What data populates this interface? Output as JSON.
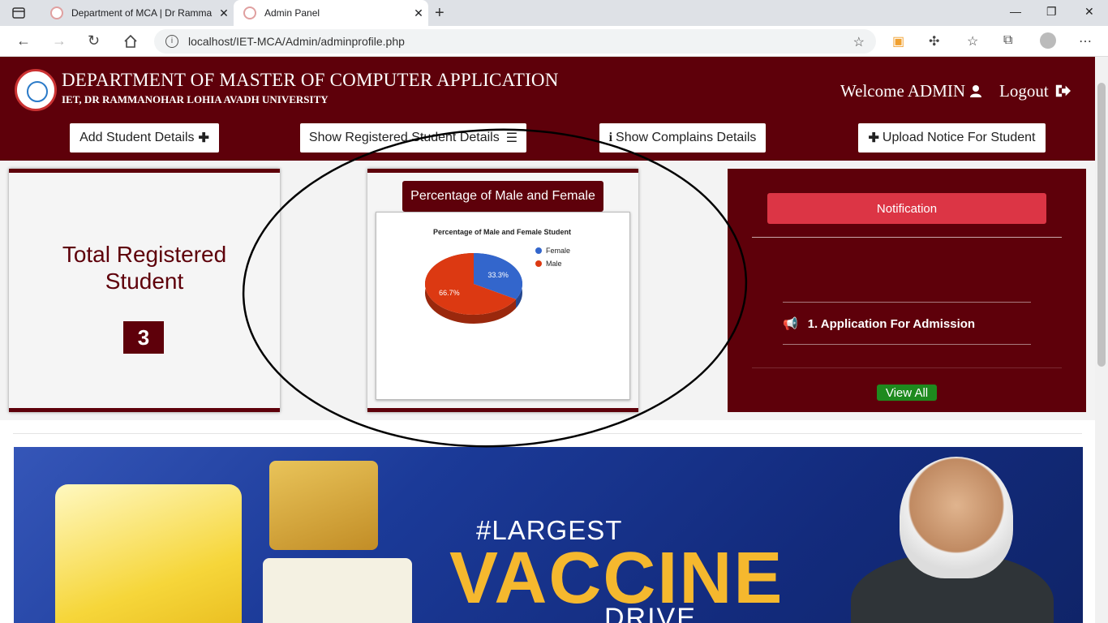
{
  "browser": {
    "tabs": [
      {
        "title": "Department of MCA | Dr Ramma",
        "active": false
      },
      {
        "title": "Admin Panel",
        "active": true
      }
    ],
    "url": "localhost/IET-MCA/Admin/adminprofile.php"
  },
  "header": {
    "title": "DEPARTMENT OF MASTER OF COMPUTER APPLICATION",
    "subtitle": "IET, DR RAMMANOHAR LOHIA AVADH UNIVERSITY",
    "welcome": "Welcome ADMIN",
    "logout": "Logout"
  },
  "nav": {
    "add_student": "Add Student Details",
    "show_registered": "Show Registered Student Details",
    "show_complains": "Show Complains Details",
    "upload_notice": "Upload Notice For Student"
  },
  "total_card": {
    "title": "Total Registered Student",
    "count": "3"
  },
  "chart_card": {
    "heading": "Percentage of Male and Female"
  },
  "chart_data": {
    "type": "pie",
    "title": "Percentage of Male and Female Student",
    "legend_position": "top-right",
    "slices": [
      {
        "label": "Female",
        "value": 33.3,
        "display": "33.3%",
        "color": "#3366cc"
      },
      {
        "label": "Male",
        "value": 66.7,
        "display": "66.7%",
        "color": "#dc3912"
      }
    ]
  },
  "notification": {
    "button": "Notification",
    "items": [
      {
        "text": "1. Application For Admission"
      }
    ],
    "view_all": "View All"
  },
  "banner": {
    "hashtag": "#LARGEST",
    "headline": "VACCINE",
    "sub": "DRIVE"
  },
  "colors": {
    "maroon": "#5e000a",
    "notif_red": "#dc3545",
    "view_all_green": "#1e8a1e"
  }
}
